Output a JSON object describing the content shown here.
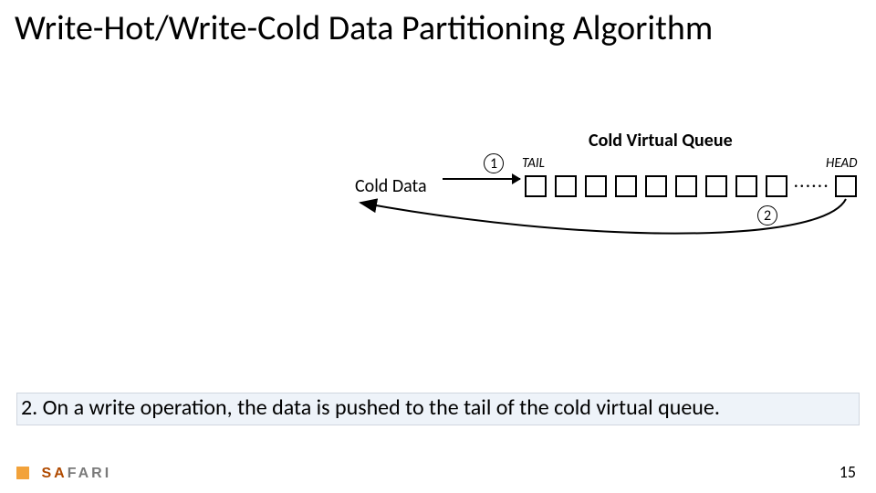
{
  "title": "Write-Hot/Write-Cold Data Partitioning Algorithm",
  "diagram": {
    "queue_title": "Cold Virtual Queue",
    "tail": "TAIL",
    "head": "HEAD",
    "cold_data": "Cold Data",
    "step1": "1",
    "step2": "2",
    "ellipsis": "······",
    "visible_cells": 9,
    "extra_cell_after_gap": 1
  },
  "step_text": "2. On a write operation, the data is pushed to the tail of the cold virtual queue.",
  "footer": {
    "logo_a": "SA",
    "logo_b": "FARI",
    "page": "15"
  }
}
